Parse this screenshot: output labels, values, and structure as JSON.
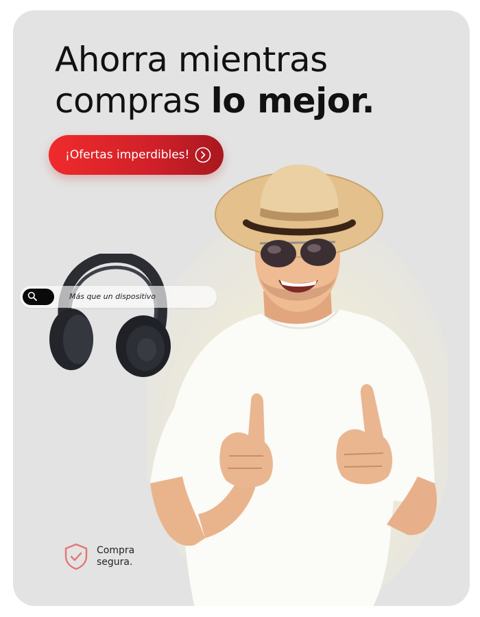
{
  "headline": {
    "line1": "Ahorra mientras",
    "line2_regular": "compras ",
    "line2_bold": "lo mejor."
  },
  "cta": {
    "label": "¡Ofertas imperdibles!",
    "icon": "chevron-right-circle-icon"
  },
  "search": {
    "text": "Más que un dispositivo",
    "icon": "search-icon"
  },
  "badge": {
    "line1": "Compra",
    "line2": "segura.",
    "icon": "shield-check-icon"
  },
  "colors": {
    "card_background": "#e3e3e3",
    "accent_red": "#e52a2a",
    "text_dark": "#111111",
    "shield_red": "#e57373"
  }
}
